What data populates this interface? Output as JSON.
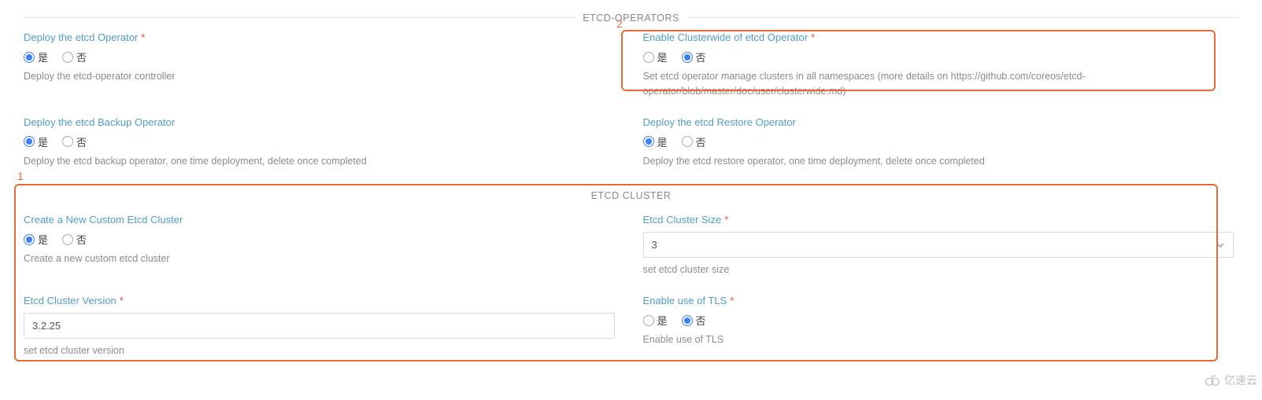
{
  "sections": {
    "operators_title": "ETCD-OPERATORS",
    "cluster_title": "ETCD CLUSTER"
  },
  "radio": {
    "yes": "是",
    "no": "否"
  },
  "fields": {
    "deploy_operator": {
      "label": "Deploy the etcd Operator",
      "required": true,
      "value": "yes",
      "help": "Deploy the etcd-operator controller"
    },
    "enable_clusterwide": {
      "label": "Enable Clusterwide of etcd Operator",
      "required": true,
      "value": "no",
      "help": "Set etcd operator manage clusters in all namespaces (more details on https://github.com/coreos/etcd-operator/blob/master/doc/user/clusterwide.md)"
    },
    "deploy_backup": {
      "label": "Deploy the etcd Backup Operator",
      "required": false,
      "value": "yes",
      "help": "Deploy the etcd backup operator, one time deployment, delete once completed"
    },
    "deploy_restore": {
      "label": "Deploy the etcd Restore Operator",
      "required": false,
      "value": "yes",
      "help": "Deploy the etcd restore operator, one time deployment, delete once completed"
    },
    "create_cluster": {
      "label": "Create a New Custom Etcd Cluster",
      "required": false,
      "value": "yes",
      "help": "Create a new custom etcd cluster"
    },
    "cluster_size": {
      "label": "Etcd Cluster Size",
      "required": true,
      "value": "3",
      "help": "set etcd cluster size"
    },
    "cluster_version": {
      "label": "Etcd Cluster Version",
      "required": true,
      "value": "3.2.25",
      "help": "set etcd cluster version"
    },
    "enable_tls": {
      "label": "Enable use of TLS",
      "required": true,
      "value": "no",
      "help": "Enable use of TLS"
    }
  },
  "annotations": {
    "one": "1",
    "two": "2"
  },
  "watermark": "亿速云"
}
